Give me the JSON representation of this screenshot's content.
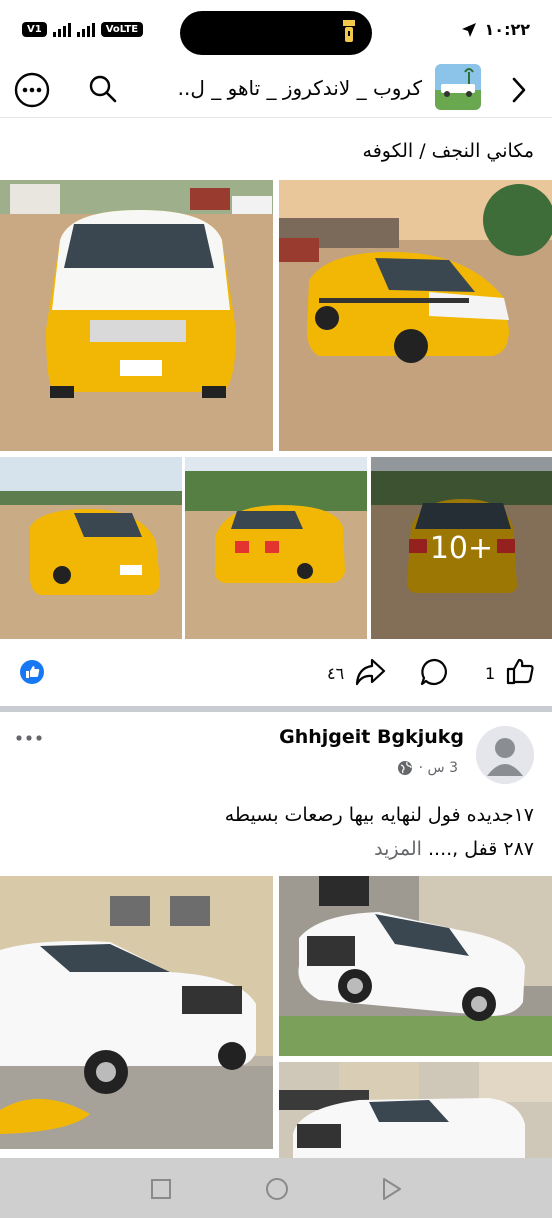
{
  "status_bar": {
    "time": "١٠:٢٢",
    "network_badge": "VoLTE",
    "carrier_badge": "V1"
  },
  "header": {
    "group_title": "كروب _ لاندكروز _ تاهو _ ل.."
  },
  "post1": {
    "location_text": "مكاني النجف / الكوفه",
    "more_photos": "10+",
    "like_count": "1",
    "share_count": "٤٦"
  },
  "post2": {
    "author": "Ghhjgeit Bgkjukg",
    "time": "3 س ·",
    "body_line1": "١٧جديده فول لنهايه بيها رصعات بسيطه",
    "body_line2": "٢٨٧ قفل ,....",
    "see_more": "المزيد"
  },
  "colors": {
    "accent": "#1877f2",
    "taxi_yellow": "#f2b705",
    "divider": "#c9ccd1"
  }
}
